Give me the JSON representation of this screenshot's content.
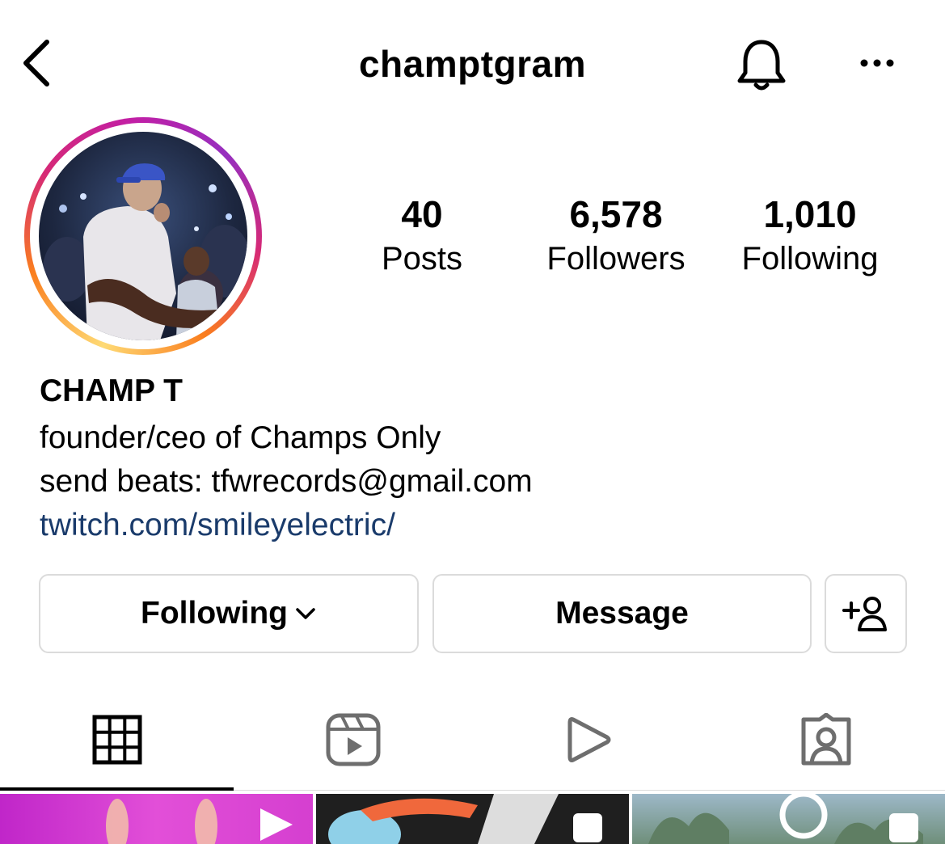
{
  "header": {
    "username": "champtgram",
    "back_icon": "chevron-left-icon",
    "bell_icon": "bell-icon",
    "more_icon": "more-horizontal-icon"
  },
  "profile": {
    "stats": [
      {
        "value": "40",
        "label": "Posts"
      },
      {
        "value": "6,578",
        "label": "Followers"
      },
      {
        "value": "1,010",
        "label": "Following"
      }
    ],
    "display_name": "CHAMP T",
    "bio": [
      "founder/ceo of Champs Only",
      "send beats: tfwrecords@gmail.com"
    ],
    "link": "twitch.com/smileyelectric/"
  },
  "actions": {
    "following_label": "Following",
    "message_label": "Message",
    "add_person_icon": "add-person-icon"
  },
  "tabs": [
    {
      "icon": "grid-icon",
      "active": true
    },
    {
      "icon": "reels-icon",
      "active": false
    },
    {
      "icon": "play-icon",
      "active": false
    },
    {
      "icon": "tagged-icon",
      "active": false
    }
  ],
  "colors": {
    "link": "#1a3b6b",
    "border": "#dbdbdb",
    "inactive_icon": "#6e6e6e"
  }
}
